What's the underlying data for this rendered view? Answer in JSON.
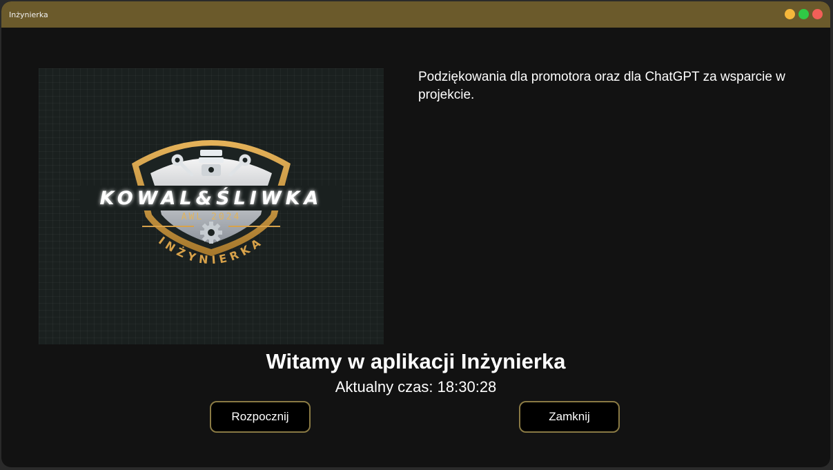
{
  "window": {
    "title": "Inżynierka",
    "buttons": {
      "minimize_color": "#f5b73b",
      "maximize_color": "#30c945",
      "close_color": "#f25f58"
    }
  },
  "logo": {
    "main_text": "KOWAL&ŚLIWKA",
    "sub_text": "AWL 2024",
    "arc_text": "INŻYNIERKA"
  },
  "thanks_text": "Podziękowania dla promotora oraz dla ChatGPT za wsparcie w projekcie.",
  "welcome_title": "Witamy w aplikacji Inżynierka",
  "time_label": "Aktualny czas:",
  "time_value": "18:30:28",
  "actions": {
    "start_label": "Rozpocznij",
    "close_label": "Zamknij"
  },
  "colors": {
    "title_bar": "#6b5a2b",
    "background": "#121212",
    "button_border": "#8a7a44",
    "logo_gold": "#d8a24a"
  }
}
